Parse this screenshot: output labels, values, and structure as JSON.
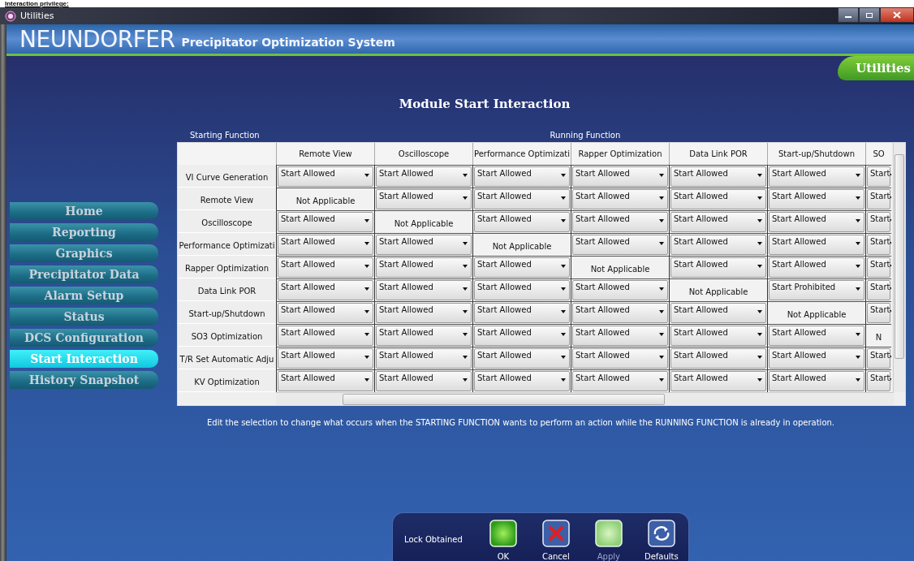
{
  "caption": "Interaction privilege:",
  "window": {
    "title": "Utilities"
  },
  "header": {
    "brand": "NEUNDORFER",
    "subtitle": "Precipitator Optimization System"
  },
  "section_tab": "Utilities",
  "page_title": "Module Start Interaction",
  "axis_labels": {
    "rows": "Starting Function",
    "columns": "Running Function"
  },
  "sidebar": {
    "items": [
      {
        "label": "Home",
        "selected": false
      },
      {
        "label": "Reporting",
        "selected": false
      },
      {
        "label": "Graphics",
        "selected": false
      },
      {
        "label": "Precipitator Data",
        "selected": false
      },
      {
        "label": "Alarm Setup",
        "selected": false
      },
      {
        "label": "Status",
        "selected": false
      },
      {
        "label": "DCS Configuration",
        "selected": false
      },
      {
        "label": "Start Interaction",
        "selected": true
      },
      {
        "label": "History Snapshot",
        "selected": false
      }
    ]
  },
  "table": {
    "columns": [
      "Remote View",
      "Oscilloscope",
      "Performance Optimizati",
      "Rapper Optimization",
      "Data Link POR",
      "Start-up/Shutdown",
      "SO"
    ],
    "rows": [
      {
        "label": "VI Curve Generation",
        "cells": [
          {
            "kind": "select",
            "value": "Start Allowed"
          },
          {
            "kind": "select",
            "value": "Start Allowed"
          },
          {
            "kind": "select",
            "value": "Start Allowed"
          },
          {
            "kind": "select",
            "value": "Start Allowed"
          },
          {
            "kind": "select",
            "value": "Start Allowed"
          },
          {
            "kind": "select",
            "value": "Start Allowed"
          },
          {
            "kind": "select",
            "value": "Start"
          }
        ]
      },
      {
        "label": "Remote View",
        "cells": [
          {
            "kind": "fixed",
            "value": "Not Applicable"
          },
          {
            "kind": "select",
            "value": "Start Allowed"
          },
          {
            "kind": "select",
            "value": "Start Allowed"
          },
          {
            "kind": "select",
            "value": "Start Allowed"
          },
          {
            "kind": "select",
            "value": "Start Allowed"
          },
          {
            "kind": "select",
            "value": "Start Allowed"
          },
          {
            "kind": "select",
            "value": "Start"
          }
        ]
      },
      {
        "label": "Oscilloscope",
        "cells": [
          {
            "kind": "select",
            "value": "Start Allowed"
          },
          {
            "kind": "fixed",
            "value": "Not Applicable"
          },
          {
            "kind": "select",
            "value": "Start Allowed"
          },
          {
            "kind": "select",
            "value": "Start Allowed"
          },
          {
            "kind": "select",
            "value": "Start Allowed"
          },
          {
            "kind": "select",
            "value": "Start Allowed"
          },
          {
            "kind": "select",
            "value": "Start"
          }
        ]
      },
      {
        "label": "Performance Optimizati",
        "cells": [
          {
            "kind": "select",
            "value": "Start Allowed"
          },
          {
            "kind": "select",
            "value": "Start Allowed"
          },
          {
            "kind": "fixed",
            "value": "Not Applicable"
          },
          {
            "kind": "select",
            "value": "Start Allowed"
          },
          {
            "kind": "select",
            "value": "Start Allowed"
          },
          {
            "kind": "select",
            "value": "Start Allowed"
          },
          {
            "kind": "select",
            "value": "Start"
          }
        ]
      },
      {
        "label": "Rapper Optimization",
        "cells": [
          {
            "kind": "select",
            "value": "Start Allowed"
          },
          {
            "kind": "select",
            "value": "Start Allowed"
          },
          {
            "kind": "select",
            "value": "Start Allowed"
          },
          {
            "kind": "fixed",
            "value": "Not Applicable"
          },
          {
            "kind": "select",
            "value": "Start Allowed"
          },
          {
            "kind": "select",
            "value": "Start Allowed"
          },
          {
            "kind": "select",
            "value": "Start"
          }
        ]
      },
      {
        "label": "Data Link POR",
        "cells": [
          {
            "kind": "select",
            "value": "Start Allowed"
          },
          {
            "kind": "select",
            "value": "Start Allowed"
          },
          {
            "kind": "select",
            "value": "Start Allowed"
          },
          {
            "kind": "select",
            "value": "Start Allowed"
          },
          {
            "kind": "fixed",
            "value": "Not Applicable"
          },
          {
            "kind": "select",
            "value": "Start Prohibited"
          },
          {
            "kind": "select",
            "value": "Start"
          }
        ]
      },
      {
        "label": "Start-up/Shutdown",
        "cells": [
          {
            "kind": "select",
            "value": "Start Allowed"
          },
          {
            "kind": "select",
            "value": "Start Allowed"
          },
          {
            "kind": "select",
            "value": "Start Allowed"
          },
          {
            "kind": "select",
            "value": "Start Allowed"
          },
          {
            "kind": "select",
            "value": "Start Allowed"
          },
          {
            "kind": "fixed",
            "value": "Not Applicable"
          },
          {
            "kind": "select",
            "value": "Start"
          }
        ]
      },
      {
        "label": "SO3 Optimization",
        "cells": [
          {
            "kind": "select",
            "value": "Start Allowed"
          },
          {
            "kind": "select",
            "value": "Start Allowed"
          },
          {
            "kind": "select",
            "value": "Start Allowed"
          },
          {
            "kind": "select",
            "value": "Start Allowed"
          },
          {
            "kind": "select",
            "value": "Start Allowed"
          },
          {
            "kind": "select",
            "value": "Start Allowed"
          },
          {
            "kind": "fixed",
            "value": "N"
          }
        ]
      },
      {
        "label": "T/R Set Automatic Adju",
        "cells": [
          {
            "kind": "select",
            "value": "Start Allowed"
          },
          {
            "kind": "select",
            "value": "Start Allowed"
          },
          {
            "kind": "select",
            "value": "Start Allowed"
          },
          {
            "kind": "select",
            "value": "Start Allowed"
          },
          {
            "kind": "select",
            "value": "Start Allowed"
          },
          {
            "kind": "select",
            "value": "Start Allowed"
          },
          {
            "kind": "select",
            "value": "Start"
          }
        ]
      },
      {
        "label": "KV Optimization",
        "cells": [
          {
            "kind": "select",
            "value": "Start Allowed"
          },
          {
            "kind": "select",
            "value": "Start Allowed"
          },
          {
            "kind": "select",
            "value": "Start Allowed"
          },
          {
            "kind": "select",
            "value": "Start Allowed"
          },
          {
            "kind": "select",
            "value": "Start Allowed"
          },
          {
            "kind": "select",
            "value": "Start Allowed"
          },
          {
            "kind": "select",
            "value": "Start"
          }
        ]
      }
    ]
  },
  "note": "Edit the selection to change what occurs when the STARTING FUNCTION wants to perform an action while the RUNNING FUNCTION is already in operation.",
  "footer": {
    "status": "Lock Obtained",
    "buttons": [
      {
        "kind": "ok",
        "label": "OK",
        "disabled": false
      },
      {
        "kind": "cancel",
        "label": "Cancel",
        "disabled": false
      },
      {
        "kind": "apply",
        "label": "Apply",
        "disabled": true
      },
      {
        "kind": "defaults",
        "label": "Defaults",
        "disabled": false
      }
    ]
  }
}
